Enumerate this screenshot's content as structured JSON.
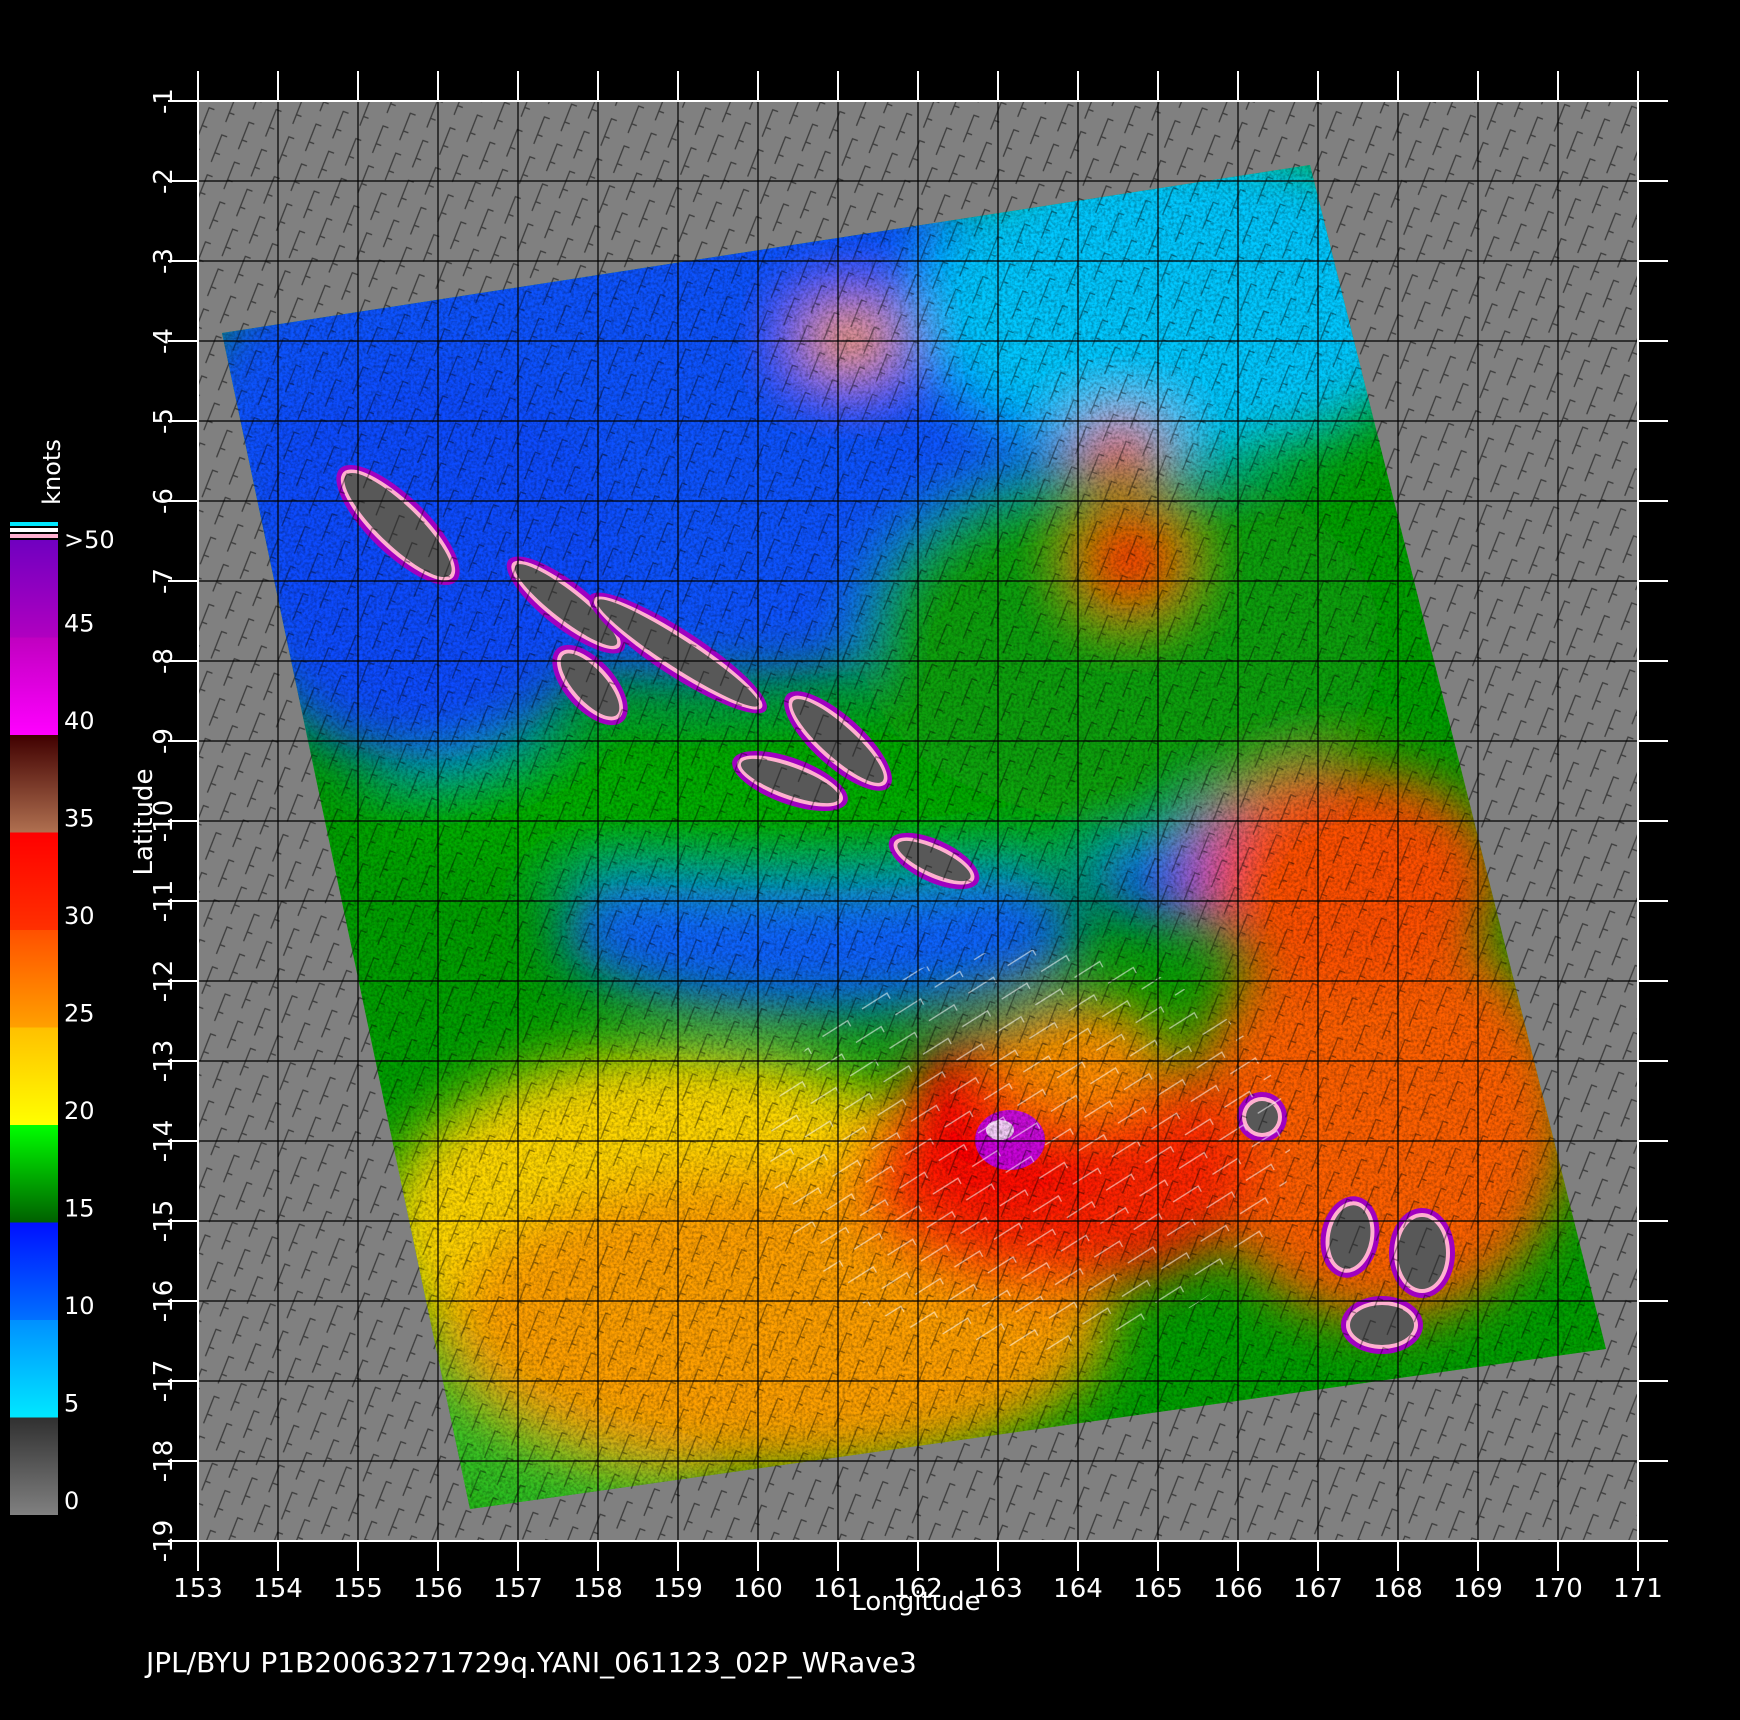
{
  "footer": "JPL/BYU  P1B20063271729q.YANI_061123_02P_WRave3",
  "map": {
    "x_label": "Longitude",
    "y_label": "Latitude",
    "lon_range": [
      153,
      171
    ],
    "lat_range": [
      -19,
      -1
    ],
    "lon_ticks": [
      "153",
      "154",
      "155",
      "156",
      "157",
      "158",
      "159",
      "160",
      "161",
      "162",
      "163",
      "164",
      "165",
      "166",
      "167",
      "168",
      "169",
      "170",
      "171"
    ],
    "lat_ticks": [
      "-1",
      "-2",
      "-3",
      "-4",
      "-5",
      "-6",
      "-7",
      "-8",
      "-9",
      "-10",
      "-11",
      "-12",
      "-13",
      "-14",
      "-15",
      "-16",
      "-17",
      "-18",
      "-19"
    ],
    "grid": true,
    "swath_corners_lonlat": [
      [
        153.3,
        -3.9
      ],
      [
        166.9,
        -1.8
      ],
      [
        170.6,
        -16.6
      ],
      [
        156.4,
        -18.6
      ]
    ],
    "storm_center_lonlat": [
      163.0,
      -13.9
    ],
    "islands_lonlat": [
      {
        "lon": 155.5,
        "lat": -6.3,
        "w": 1.8,
        "h": 0.5,
        "rot": 44
      },
      {
        "lon": 157.6,
        "lat": -7.3,
        "w": 1.6,
        "h": 0.35,
        "rot": 38
      },
      {
        "lon": 159.0,
        "lat": -7.9,
        "w": 2.4,
        "h": 0.35,
        "rot": 33
      },
      {
        "lon": 157.9,
        "lat": -8.3,
        "w": 1.0,
        "h": 0.4,
        "rot": 48
      },
      {
        "lon": 161.0,
        "lat": -9.0,
        "w": 1.5,
        "h": 0.4,
        "rot": 42
      },
      {
        "lon": 160.4,
        "lat": -9.5,
        "w": 1.3,
        "h": 0.35,
        "rot": 20
      },
      {
        "lon": 162.2,
        "lat": -10.5,
        "w": 1.0,
        "h": 0.3,
        "rot": 25
      },
      {
        "lon": 168.3,
        "lat": -15.4,
        "w": 0.6,
        "h": 0.9,
        "rot": 0
      },
      {
        "lon": 167.4,
        "lat": -15.2,
        "w": 0.5,
        "h": 0.8,
        "rot": 10
      },
      {
        "lon": 167.8,
        "lat": -16.3,
        "w": 0.8,
        "h": 0.5,
        "rot": 0
      },
      {
        "lon": 166.3,
        "lat": -13.7,
        "w": 0.4,
        "h": 0.4,
        "rot": 0
      }
    ]
  },
  "colorbar": {
    "title": "knots",
    "labels": [
      ">50",
      "45",
      "40",
      "35",
      "30",
      "25",
      "20",
      "15",
      "10",
      "5",
      "0"
    ],
    "segments": [
      {
        "from": 0,
        "to": 5,
        "colors": [
          "#808080",
          "#303030"
        ]
      },
      {
        "from": 5,
        "to": 10,
        "colors": [
          "#00e8ff",
          "#0090ff"
        ]
      },
      {
        "from": 10,
        "to": 15,
        "colors": [
          "#0070ff",
          "#0010ff"
        ]
      },
      {
        "from": 15,
        "to": 20,
        "colors": [
          "#006000",
          "#00ff00"
        ]
      },
      {
        "from": 20,
        "to": 25,
        "colors": [
          "#ffff00",
          "#ffc000"
        ]
      },
      {
        "from": 25,
        "to": 30,
        "colors": [
          "#ffa000",
          "#ff5000"
        ]
      },
      {
        "from": 30,
        "to": 35,
        "colors": [
          "#ff3000",
          "#ff0000"
        ]
      },
      {
        "from": 35,
        "to": 40,
        "colors": [
          "#b07050",
          "#400000"
        ]
      },
      {
        "from": 40,
        "to": 45,
        "colors": [
          "#ff00ff",
          "#c000c0"
        ]
      },
      {
        "from": 45,
        "to": 50,
        "colors": [
          "#b000c0",
          "#7000c0"
        ]
      }
    ]
  },
  "colors": {
    "background": "#000000",
    "no_data": "#808080",
    "grid": "#000000",
    "text": "#ffffff"
  }
}
